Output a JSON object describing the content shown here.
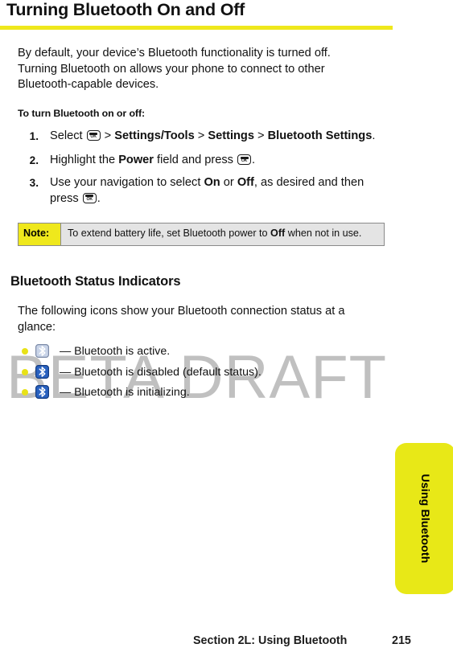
{
  "document": {
    "title": "Turning Bluetooth On and Off",
    "watermark": "BETA DRAFT",
    "accent_color": "#efe81c",
    "tab_color": "#e8e817",
    "note_fill_color": "#e4e4e4"
  },
  "intro": {
    "paragraph": "By default, your device’s Bluetooth functionality is turned off. Turning Bluetooth on allows your phone to connect to other Bluetooth-capable devices."
  },
  "procedure": {
    "lead": "To turn Bluetooth on or off:",
    "steps": [
      {
        "number": "1.",
        "parts": [
          {
            "type": "text",
            "value": "Select "
          },
          {
            "type": "key",
            "value": "OK"
          },
          {
            "type": "text",
            "value": " > "
          },
          {
            "type": "bold",
            "value": "Settings/Tools"
          },
          {
            "type": "text",
            "value": " > "
          },
          {
            "type": "bold",
            "value": "Settings"
          },
          {
            "type": "text",
            "value": " > "
          },
          {
            "type": "bold",
            "value": "Bluetooth Settings"
          },
          {
            "type": "text",
            "value": "."
          }
        ]
      },
      {
        "number": "2.",
        "parts": [
          {
            "type": "text",
            "value": "Highlight the "
          },
          {
            "type": "bold",
            "value": "Power"
          },
          {
            "type": "text",
            "value": " field and press "
          },
          {
            "type": "key",
            "value": "OK"
          },
          {
            "type": "text",
            "value": "."
          }
        ]
      },
      {
        "number": "3.",
        "parts": [
          {
            "type": "text",
            "value": "Use your navigation to select "
          },
          {
            "type": "bold",
            "value": "On"
          },
          {
            "type": "text",
            "value": " or "
          },
          {
            "type": "bold",
            "value": "Off"
          },
          {
            "type": "text",
            "value": ", as desired and then press "
          },
          {
            "type": "key",
            "value": "OK"
          },
          {
            "type": "text",
            "value": "."
          }
        ]
      }
    ]
  },
  "note": {
    "label": "Note:",
    "parts": [
      {
        "type": "text",
        "value": "To extend battery life, set Bluetooth power to "
      },
      {
        "type": "bold",
        "value": "Off"
      },
      {
        "type": "text",
        "value": " when not in use."
      }
    ]
  },
  "status_section": {
    "heading": "Bluetooth Status Indicators",
    "paragraph": "The following icons show your Bluetooth connection status at a glance:",
    "items": [
      {
        "icon": "bluetooth-active-icon",
        "icon_style": "light",
        "label": "— Bluetooth is active."
      },
      {
        "icon": "bluetooth-disabled-icon",
        "icon_style": "dark",
        "label": "— Bluetooth is disabled (default status)."
      },
      {
        "icon": "bluetooth-initializing-icon",
        "icon_style": "dark",
        "label": "— Bluetooth is initializing."
      }
    ]
  },
  "side_tab": {
    "label": "Using Bluetooth"
  },
  "footer": {
    "section": "Section 2L: Using Bluetooth",
    "page": "215"
  }
}
